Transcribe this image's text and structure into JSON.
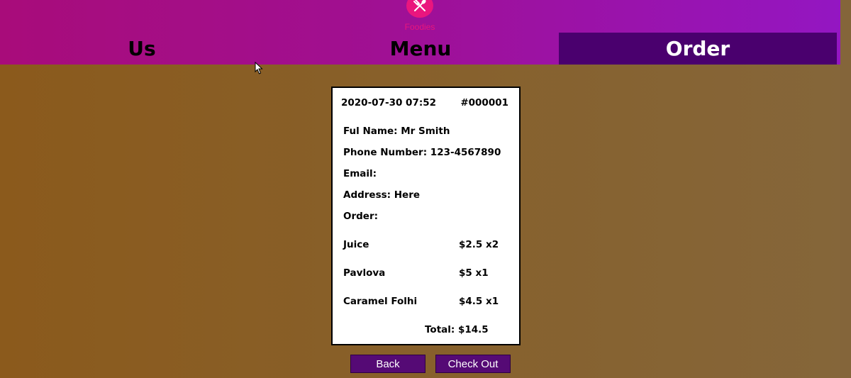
{
  "app": {
    "logo_text": "Foodies",
    "accent_color": "#e8167c",
    "header_gradient": [
      "#a80c7a",
      "#9416c2"
    ],
    "active_tab_color": "#4a006e"
  },
  "nav": {
    "tabs": [
      {
        "label": "Us",
        "active": false
      },
      {
        "label": "Menu",
        "active": false
      },
      {
        "label": "Order",
        "active": true
      }
    ]
  },
  "receipt": {
    "datetime": "2020-07-30 07:52",
    "order_number": "#000001",
    "full_name_line": "Ful Name: Mr Smith",
    "phone_line": "Phone Number: 123-4567890",
    "email_line": "Email:",
    "address_line": "Address: Here",
    "order_heading": "Order:",
    "items": [
      {
        "name": "Juice",
        "price_qty": "$2.5 x2"
      },
      {
        "name": "Pavlova",
        "price_qty": "$5 x1"
      },
      {
        "name": "Caramel Folhi",
        "price_qty": "$4.5 x1"
      }
    ],
    "total_line": "Total: $14.5"
  },
  "actions": {
    "back_label": "Back",
    "checkout_label": "Check Out"
  }
}
